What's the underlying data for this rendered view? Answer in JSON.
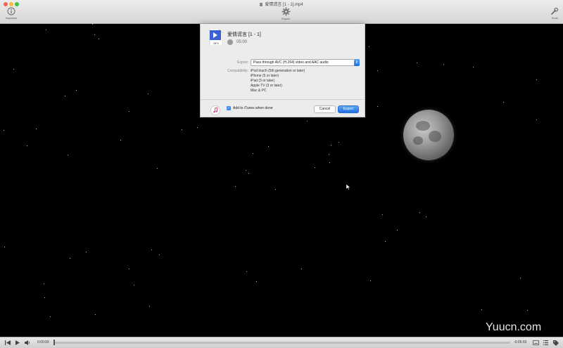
{
  "window": {
    "title": "爱情谎言 [1 - 1].mp4"
  },
  "toolbar": {
    "inspector_label": "Inspector",
    "export_label": "Export",
    "tools_label": "Tools"
  },
  "sheet": {
    "file_icon_text": "MP4",
    "file_title": "爱情谎言 [1 - 1]",
    "duration": "05:00",
    "export_label": "Export:",
    "export_value": "Pass through AVC (H.264) video and AAC audio",
    "compatibility_label": "Compatibility:",
    "compatibility_items": [
      "iPod touch (5th generation or later)",
      "iPhone (5 or later)",
      "iPad (3 or later)",
      "Apple TV (3 or later)",
      "Mac & PC"
    ],
    "add_to_itunes_label": "Add to iTunes when done",
    "add_to_itunes_checked": true,
    "cancel_label": "Cancel",
    "export_button_label": "Export"
  },
  "controls": {
    "time_elapsed": "0:00:00",
    "time_remaining": "-0:05:00",
    "progress": 0
  },
  "watermark": "Yuucn.com",
  "colors": {
    "accent": "#1f6fe0",
    "background": "#000000",
    "sheet": "#ececec"
  }
}
